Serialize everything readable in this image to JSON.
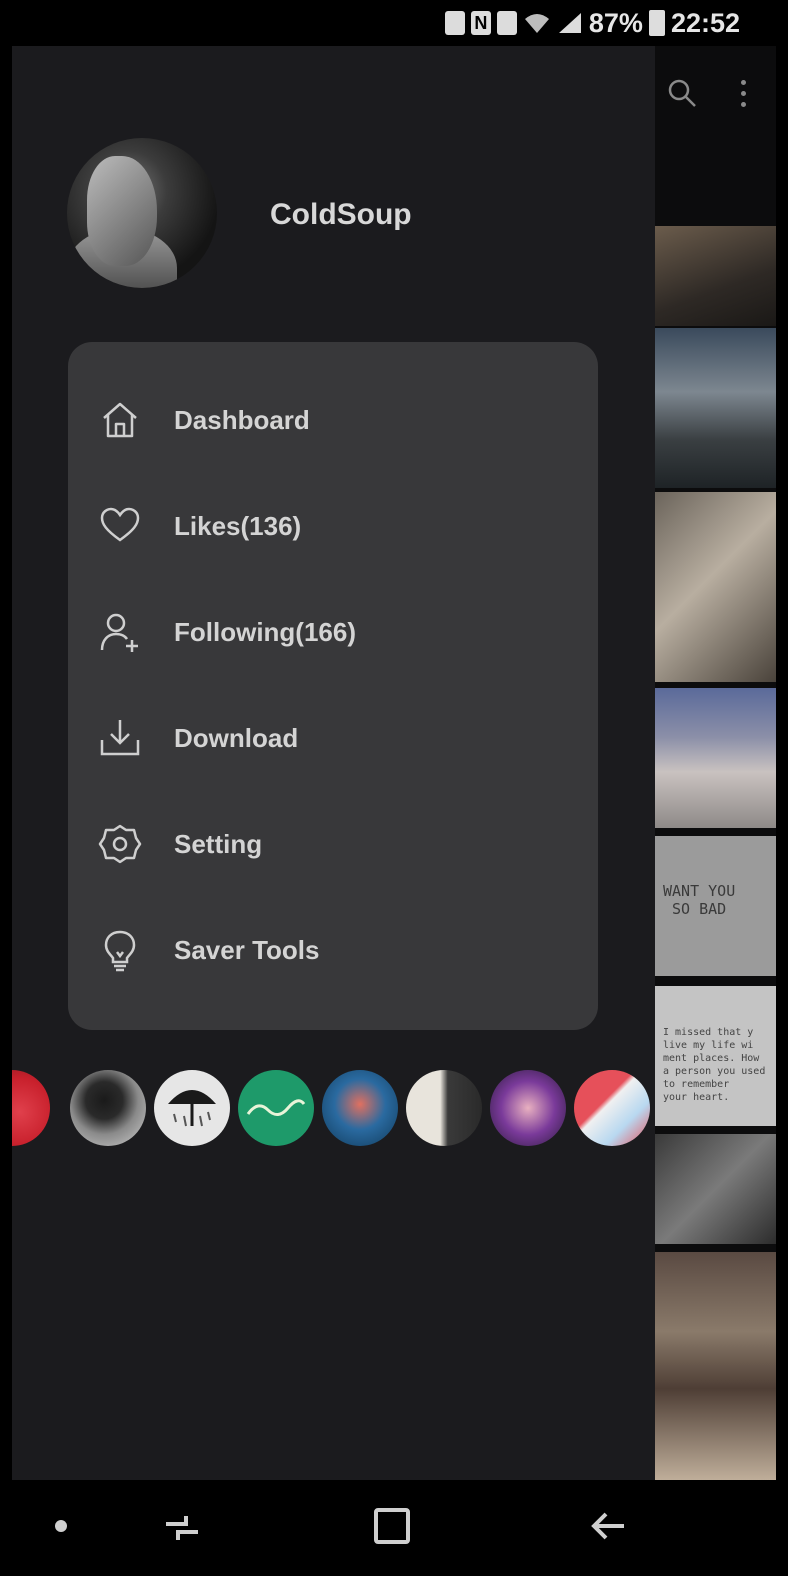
{
  "status_bar": {
    "battery_percent": "87%",
    "time": "22:52",
    "icons": [
      "photo-notification-icon",
      "nfc-icon",
      "gallery-notification-icon",
      "wifi-icon",
      "signal-icon",
      "battery-icon"
    ]
  },
  "background_app": {
    "toolbar_icons": [
      "search-icon",
      "more-vert-icon"
    ],
    "thumbnails": [
      {
        "name": "thumb-1",
        "text": ""
      },
      {
        "name": "thumb-2",
        "text": ""
      },
      {
        "name": "thumb-3",
        "text": ""
      },
      {
        "name": "thumb-4",
        "text": ""
      },
      {
        "name": "thumb-5",
        "text": "WANT YOU\n SO BAD"
      },
      {
        "name": "thumb-6",
        "text": "I missed that y\nlive my life wi\nment places. How\na person you used\nto remember\nyour heart."
      },
      {
        "name": "thumb-7",
        "text": ""
      },
      {
        "name": "thumb-8",
        "text": ""
      }
    ]
  },
  "drawer": {
    "profile": {
      "username": "ColdSoup"
    },
    "menu": [
      {
        "name": "menu-item-dashboard",
        "icon": "home-icon",
        "label": "Dashboard"
      },
      {
        "name": "menu-item-likes",
        "icon": "heart-icon",
        "label": "Likes(136)"
      },
      {
        "name": "menu-item-following",
        "icon": "add-user-icon",
        "label": "Following(166)"
      },
      {
        "name": "menu-item-download",
        "icon": "download-icon",
        "label": "Download"
      },
      {
        "name": "menu-item-setting",
        "icon": "gear-icon",
        "label": "Setting"
      },
      {
        "name": "menu-item-saver-tools",
        "icon": "lightbulb-icon",
        "label": "Saver Tools"
      }
    ],
    "featured_avatars": [
      {
        "name": "cherry-avatar"
      },
      {
        "name": "silhouette-avatar"
      },
      {
        "name": "umbrella-avatar"
      },
      {
        "name": "green-script-avatar"
      },
      {
        "name": "cartoon-avatar"
      },
      {
        "name": "man-in-suit-avatar"
      },
      {
        "name": "anime-girl-avatar"
      },
      {
        "name": "red-white-avatar"
      }
    ]
  },
  "nav_bar": {
    "icons": [
      "dot-icon",
      "recents-icon",
      "home-square-icon",
      "back-arrow-icon"
    ]
  },
  "colors": {
    "drawer_bg": "#1b1b1e",
    "card_bg": "#38383a",
    "text": "#d4d4d4"
  }
}
